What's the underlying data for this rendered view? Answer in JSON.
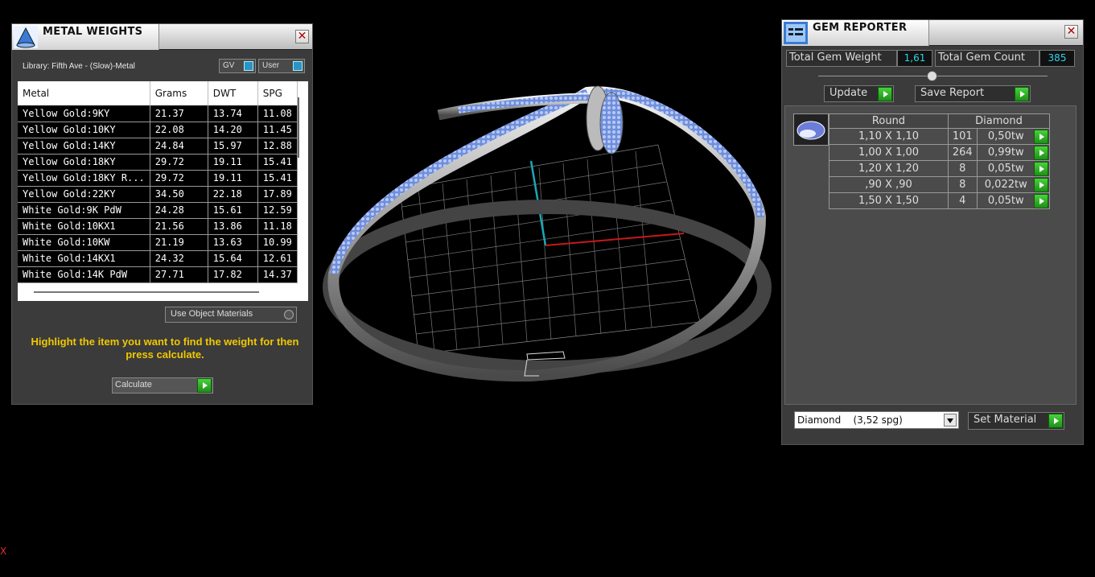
{
  "metal_weights": {
    "title": "METAL WEIGHTS",
    "library_label": "Library: Fifth Ave - (Slow)-Metal",
    "toggle_gv": "GV",
    "toggle_user": "User",
    "columns": [
      "Metal",
      "Grams",
      "DWT",
      "SPG"
    ],
    "rows": [
      [
        "Yellow Gold:9KY",
        "21.37",
        "13.74",
        "11.08"
      ],
      [
        "Yellow Gold:10KY",
        "22.08",
        "14.20",
        "11.45"
      ],
      [
        "Yellow Gold:14KY",
        "24.84",
        "15.97",
        "12.88"
      ],
      [
        "Yellow Gold:18KY",
        "29.72",
        "19.11",
        "15.41"
      ],
      [
        "Yellow Gold:18KY R...",
        "29.72",
        "19.11",
        "15.41"
      ],
      [
        "Yellow Gold:22KY",
        "34.50",
        "22.18",
        "17.89"
      ],
      [
        "White Gold:9K PdW",
        "24.28",
        "15.61",
        "12.59"
      ],
      [
        "White Gold:10KX1",
        "21.56",
        "13.86",
        "11.18"
      ],
      [
        "White Gold:10KW",
        "21.19",
        "13.63",
        "10.99"
      ],
      [
        "White Gold:14KX1",
        "24.32",
        "15.64",
        "12.61"
      ],
      [
        "White Gold:14K PdW",
        "27.71",
        "17.82",
        "14.37"
      ]
    ],
    "use_object_materials": "Use Object Materials",
    "hint": "Highlight the item you want to find the weight for then press calculate.",
    "calculate_label": "Calculate"
  },
  "gem_reporter": {
    "title": "GEM REPORTER",
    "total_weight_label": "Total Gem Weight",
    "total_weight_value": "1,61",
    "total_count_label": "Total Gem Count",
    "total_count_value": "385",
    "update_label": "Update",
    "save_report_label": "Save Report",
    "shape_header": "Round",
    "material_header": "Diamond",
    "gems": [
      {
        "size": "1,10 X 1,10",
        "count": "101",
        "weight": "0,50tw"
      },
      {
        "size": "1,00 X 1,00",
        "count": "264",
        "weight": "0,99tw"
      },
      {
        "size": "1,20 X 1,20",
        "count": "8",
        "weight": "0,05tw"
      },
      {
        "size": ",90 X ,90",
        "count": "8",
        "weight": "0,022tw"
      },
      {
        "size": "1,50 X 1,50",
        "count": "4",
        "weight": "0,05tw"
      }
    ],
    "material_select": "Diamond    (3,52 spg)",
    "set_material_label": "Set Material"
  },
  "colors": {
    "accent_cyan": "#2fd3e8",
    "hint_yellow": "#f0c800",
    "button_green": "#2fb02a"
  },
  "stray_glyph": "X"
}
